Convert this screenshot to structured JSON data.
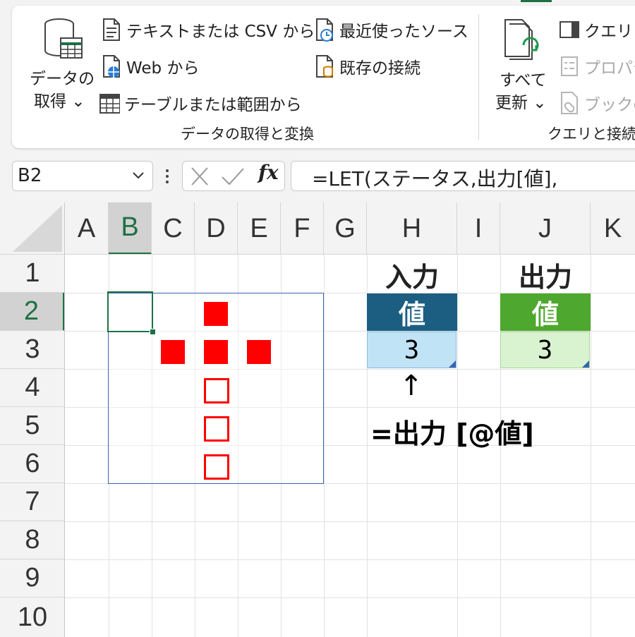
{
  "ribbon": {
    "get_data": {
      "line1": "データの",
      "line2": "取得 ⌄"
    },
    "from_text_csv": "テキストまたは CSV から",
    "from_web": "Web から",
    "from_table": "テーブルまたは範囲から",
    "recent_sources": "最近使ったソース",
    "existing_connections": "既存の接続",
    "group_get_transform": "データの取得と変換",
    "refresh_all": {
      "line1": "すべて",
      "line2": "更新 ⌄"
    },
    "queries_connections": "クエリと接",
    "properties": "プロパテ",
    "workbook_links": "ブックの",
    "group_queries": "クエリと接続"
  },
  "formula_bar": {
    "name_box": "B2",
    "fx": "fx",
    "formula": "=LET(ステータス,出力[値],"
  },
  "grid": {
    "columns": [
      "A",
      "B",
      "C",
      "D",
      "E",
      "F",
      "G",
      "H",
      "I",
      "J",
      "K"
    ],
    "rows": [
      "1",
      "2",
      "3",
      "4",
      "5",
      "6",
      "7",
      "8",
      "9",
      "10"
    ],
    "selected_column": "B",
    "selected_row": "2"
  },
  "cells": {
    "input_title": "入力",
    "output_title": "出力",
    "input_header": "値",
    "output_header": "値",
    "input_value": "3",
    "output_value": "3",
    "arrow": "↑",
    "formula_note": "=出力 [@値]"
  },
  "colors": {
    "input_header_bg": "#1b5e82",
    "input_value_bg": "#c0e3f5",
    "output_header_bg": "#4ea72e",
    "output_value_bg": "#d9f2d0",
    "shape_red": "#ff0000",
    "excel_green": "#1e7145"
  }
}
